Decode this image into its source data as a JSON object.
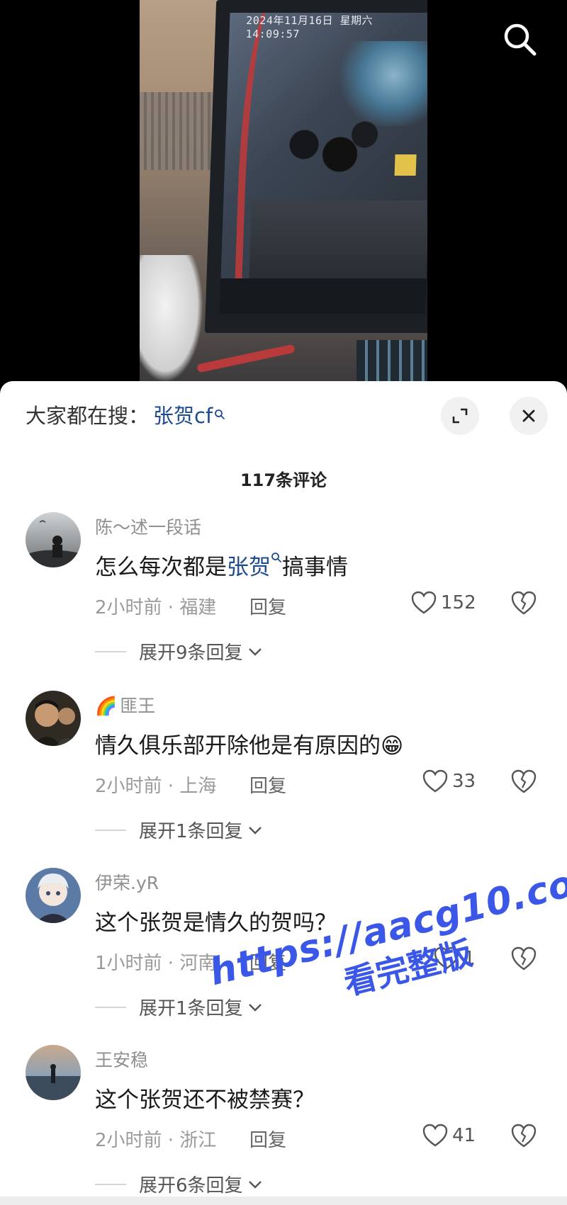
{
  "video": {
    "timestamp": "2024年11月16日 星期六 14:09:57"
  },
  "panel": {
    "trending_label": "大家都在搜：",
    "trending_keyword": "张贺cf",
    "comment_count": "117条评论"
  },
  "comments": [
    {
      "user": "陈～述一段话",
      "text_before": "怎么每次都是",
      "keyword": "张贺",
      "text_after": "搞事情",
      "meta": "2小时前 · 福建",
      "reply": "回复",
      "likes": "152",
      "expand": "展开9条回复"
    },
    {
      "user": "匪王",
      "user_prefix": "🌈",
      "text": "情久俱乐部开除他是有原因的😁",
      "meta": "2小时前 · 上海",
      "reply": "回复",
      "likes": "33",
      "expand": "展开1条回复"
    },
    {
      "user": "伊荣.yR",
      "text": "这个张贺是情久的贺吗？",
      "meta": "1小时前 · 河南",
      "reply": "回复",
      "likes": "1",
      "expand": "展开1条回复"
    },
    {
      "user": "王安稳",
      "text": "这个张贺还不被禁赛？",
      "meta": "2小时前 · 浙江",
      "reply": "回复",
      "likes": "41",
      "expand": "展开6条回复"
    }
  ],
  "watermark": {
    "line1": "https://aacg10.com",
    "line2": "看完整版"
  },
  "colors": {
    "keyword": "#1e4c8f",
    "watermark": "#3b57e8"
  }
}
